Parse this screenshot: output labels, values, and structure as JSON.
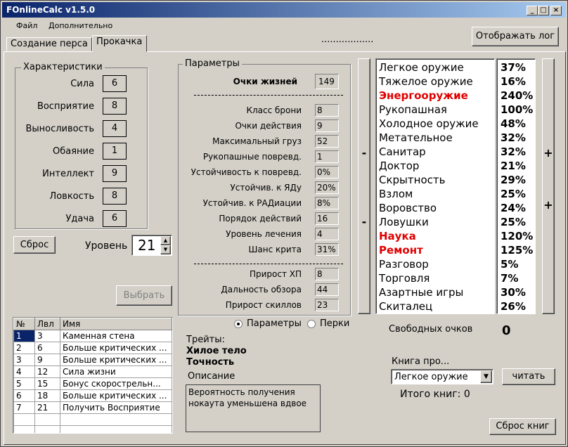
{
  "window": {
    "title": "FOnlineCalc v1.5.0",
    "min": "_",
    "max": "□",
    "close": "×"
  },
  "menu": {
    "file": "Файл",
    "extra": "Дополнительно"
  },
  "tabs": {
    "create": "Создание перса",
    "level": "Прокачка"
  },
  "dots": "..................",
  "show_log": "Отображать лог",
  "characteristics": {
    "title": "Характеристики",
    "items": [
      {
        "label": "Сила",
        "value": "6"
      },
      {
        "label": "Восприятие",
        "value": "8"
      },
      {
        "label": "Выносливость",
        "value": "4"
      },
      {
        "label": "Обаяние",
        "value": "1"
      },
      {
        "label": "Интеллект",
        "value": "9"
      },
      {
        "label": "Ловкость",
        "value": "8"
      },
      {
        "label": "Удача",
        "value": "6"
      }
    ]
  },
  "reset_button": "Сброс",
  "level": {
    "label": "Уровень",
    "value": "21",
    "up": "▲",
    "down": "▼"
  },
  "choose_button": "Выбрать",
  "params": {
    "title": "Параметры",
    "hp_label": "Очки жизней",
    "hp_value": "149",
    "items": [
      {
        "label": "Класс брони",
        "value": "8"
      },
      {
        "label": "Очки действия",
        "value": "9"
      },
      {
        "label": "Максимальный груз",
        "value": "52"
      },
      {
        "label": "Рукопашные повревд.",
        "value": "1"
      },
      {
        "label": "Устойчивость к повревд.",
        "value": "0%"
      },
      {
        "label": "Устойчив. к ЯДу",
        "value": "20%"
      },
      {
        "label": "Устойчив. к РАДиации",
        "value": "8%"
      },
      {
        "label": "Порядок действий",
        "value": "16"
      },
      {
        "label": "Уровень лечения",
        "value": "4"
      },
      {
        "label": "Шанс крита",
        "value": "31%"
      }
    ],
    "items2": [
      {
        "label": "Прирост ХП",
        "value": "8"
      },
      {
        "label": "Дальность обзора",
        "value": "44"
      },
      {
        "label": "Прирост скиллов",
        "value": "23"
      }
    ]
  },
  "radios": {
    "params": "Параметры",
    "perks": "Перки"
  },
  "traits": {
    "title": "Трейты:",
    "t1": "Хилое тело",
    "t2": "Точность"
  },
  "description": {
    "label": "Описание",
    "text": "Вероятность получения нокаута уменьшена вдвое"
  },
  "perk_table": {
    "headers": [
      "№",
      "Лвл",
      "Имя"
    ],
    "rows": [
      [
        "1",
        "3",
        "Каменная стена"
      ],
      [
        "2",
        "6",
        "Больше критических ..."
      ],
      [
        "3",
        "9",
        "Больше критических ..."
      ],
      [
        "4",
        "12",
        "Сила жизни"
      ],
      [
        "5",
        "15",
        "Бонус скорострельн..."
      ],
      [
        "6",
        "18",
        "Больше критических ..."
      ],
      [
        "7",
        "21",
        "Получить Восприятие"
      ]
    ]
  },
  "skills": [
    {
      "name": "Легкое оружие",
      "pct": "37%",
      "tag": false
    },
    {
      "name": "Тяжелое оружие",
      "pct": "16%",
      "tag": false
    },
    {
      "name": "Энергооружие",
      "pct": "240%",
      "tag": true
    },
    {
      "name": "Рукопашная",
      "pct": "100%",
      "tag": false
    },
    {
      "name": "Холодное оружие",
      "pct": "48%",
      "tag": false
    },
    {
      "name": "Метательное",
      "pct": "32%",
      "tag": false
    },
    {
      "name": "Санитар",
      "pct": "32%",
      "tag": false
    },
    {
      "name": "Доктор",
      "pct": "21%",
      "tag": false
    },
    {
      "name": "Скрытность",
      "pct": "29%",
      "tag": false
    },
    {
      "name": "Взлом",
      "pct": "25%",
      "tag": false
    },
    {
      "name": "Воровство",
      "pct": "24%",
      "tag": false
    },
    {
      "name": "Ловушки",
      "pct": "25%",
      "tag": false
    },
    {
      "name": "Наука",
      "pct": "120%",
      "tag": true
    },
    {
      "name": "Ремонт",
      "pct": "125%",
      "tag": true
    },
    {
      "name": "Разговор",
      "pct": "5%",
      "tag": false
    },
    {
      "name": "Торговля",
      "pct": "7%",
      "tag": false
    },
    {
      "name": "Азартные игры",
      "pct": "30%",
      "tag": false
    },
    {
      "name": "Скиталец",
      "pct": "26%",
      "tag": false
    }
  ],
  "minus": "-",
  "plus": "+",
  "free_points": {
    "label": "Свободных очков",
    "value": "0"
  },
  "books": {
    "label": "Книга про...",
    "selected": "Легкое оружие",
    "read": "читать",
    "total_label": "Итого книг:",
    "total": "0",
    "reset": "Сброс книг",
    "arrow": "▼"
  },
  "colors": {
    "title_start": "#0a246a",
    "tag": "#e00000",
    "selection": "#0a246a"
  }
}
